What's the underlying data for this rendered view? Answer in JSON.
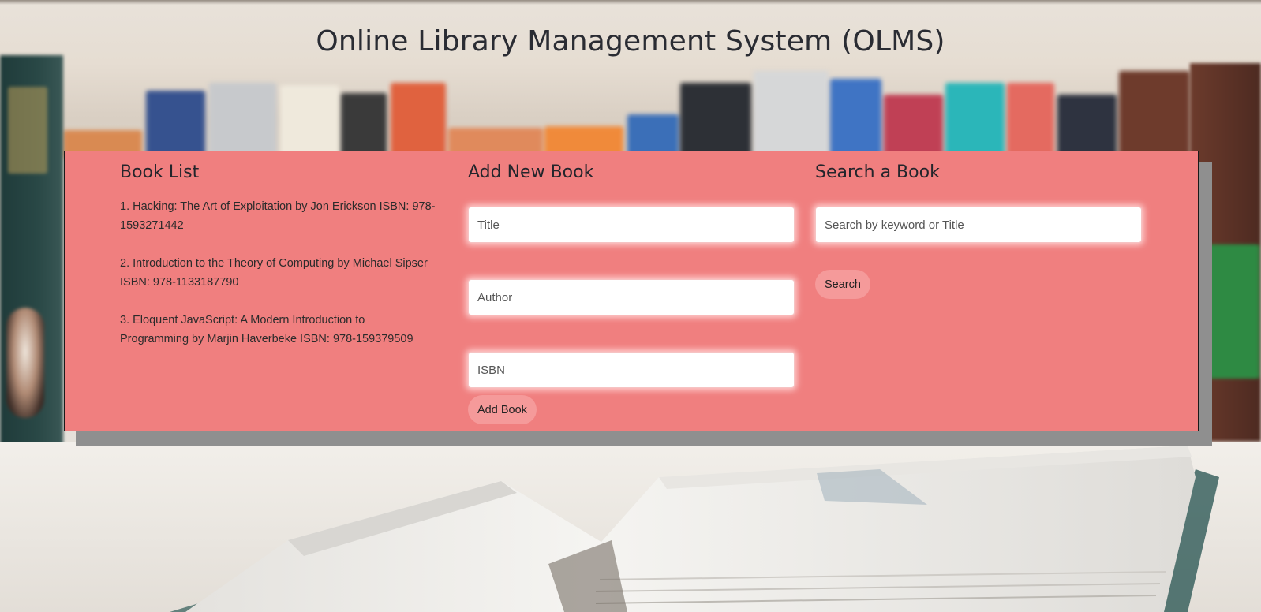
{
  "page": {
    "title": "Online Library Management System (OLMS)"
  },
  "book_list": {
    "heading": "Book List",
    "items": [
      "1. Hacking: The Art of Exploitation by Jon Erickson ISBN: 978-1593271442",
      "2. Introduction to the Theory of Computing by Michael Sipser ISBN: 978-1133187790",
      "3. Eloquent JavaScript: A Modern Introduction to Programming by Marjin Haverbeke ISBN: 978-159379509"
    ]
  },
  "add_book": {
    "heading": "Add New Book",
    "title_placeholder": "Title",
    "author_placeholder": "Author",
    "isbn_placeholder": "ISBN",
    "button_label": "Add Book"
  },
  "search": {
    "heading": "Search a Book",
    "placeholder": "Search by keyword or Title",
    "button_label": "Search"
  },
  "colors": {
    "panel": "#f07f7f",
    "button": "#f59a9a",
    "panel_border": "#1a1a1a",
    "panel_shadow": "#8f8f8f"
  }
}
